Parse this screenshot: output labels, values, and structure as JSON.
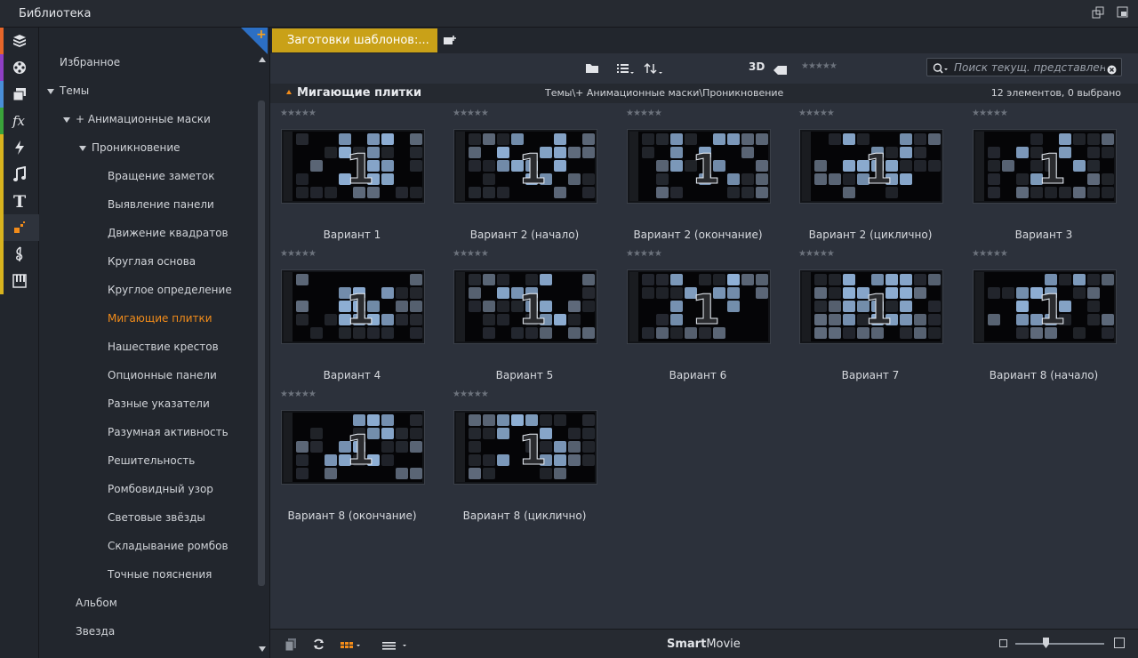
{
  "window": {
    "title": "Библиотека"
  },
  "tree": {
    "items": [
      {
        "label": "Избранное",
        "level": 0,
        "expanded": null
      },
      {
        "label": "Темы",
        "level": 0,
        "expanded": true
      },
      {
        "label": "+ Анимационные маски",
        "level": 1,
        "expanded": true
      },
      {
        "label": "Проникновение",
        "level": 2,
        "expanded": true
      },
      {
        "label": "Вращение заметок",
        "level": 3
      },
      {
        "label": "Выявление панели",
        "level": 3
      },
      {
        "label": "Движение квадратов",
        "level": 3
      },
      {
        "label": "Круглая основа",
        "level": 3
      },
      {
        "label": "Круглое определение",
        "level": 3
      },
      {
        "label": "Мигающие плитки",
        "level": 3,
        "selected": true
      },
      {
        "label": "Нашествие крестов",
        "level": 3
      },
      {
        "label": "Опционные панели",
        "level": 3
      },
      {
        "label": "Разные указатели",
        "level": 3
      },
      {
        "label": "Разумная активность",
        "level": 3
      },
      {
        "label": "Решительность",
        "level": 3
      },
      {
        "label": "Ромбовидный узор",
        "level": 3
      },
      {
        "label": "Световые звёзды",
        "level": 3
      },
      {
        "label": "Складывание ромбов",
        "level": 3
      },
      {
        "label": "Точные пояснения",
        "level": 3
      },
      {
        "label": "Альбом",
        "level": 1
      },
      {
        "label": "Звезда",
        "level": 1
      }
    ]
  },
  "tabs": {
    "active_label": "Заготовки шаблонов:..."
  },
  "toolbar": {
    "label_3d": "3D",
    "rating": "★★★★★"
  },
  "search": {
    "placeholder": "Поиск текущ. представления"
  },
  "path": {
    "title": "Мигающие плитки",
    "crumb": "Темы\\+ Анимационные маски\\Проникновение",
    "count": "12 элементов, 0 выбрано"
  },
  "items": [
    {
      "label": "Вариант 1",
      "rating": "★★★★★"
    },
    {
      "label": "Вариант 2 (начало)",
      "rating": "★★★★★"
    },
    {
      "label": "Вариант 2 (окончание)",
      "rating": "★★★★★"
    },
    {
      "label": "Вариант 2 (циклично)",
      "rating": "★★★★★"
    },
    {
      "label": "Вариант 3",
      "rating": "★★★★★"
    },
    {
      "label": "Вариант 4",
      "rating": "★★★★★"
    },
    {
      "label": "Вариант 5",
      "rating": "★★★★★"
    },
    {
      "label": "Вариант 6",
      "rating": "★★★★★"
    },
    {
      "label": "Вариант 7",
      "rating": "★★★★★"
    },
    {
      "label": "Вариант 8 (начало)",
      "rating": "★★★★★"
    },
    {
      "label": "Вариант 8 (окончание)",
      "rating": "★★★★★"
    },
    {
      "label": "Вариант 8 (циклично)",
      "rating": "★★★★★"
    }
  ],
  "bottombar": {
    "brand_bold": "Smart",
    "brand_rest": "Movie"
  },
  "colors": {
    "accent": "#f28c1a",
    "tab": "#c9a118",
    "tile": "#8fb0d6"
  }
}
